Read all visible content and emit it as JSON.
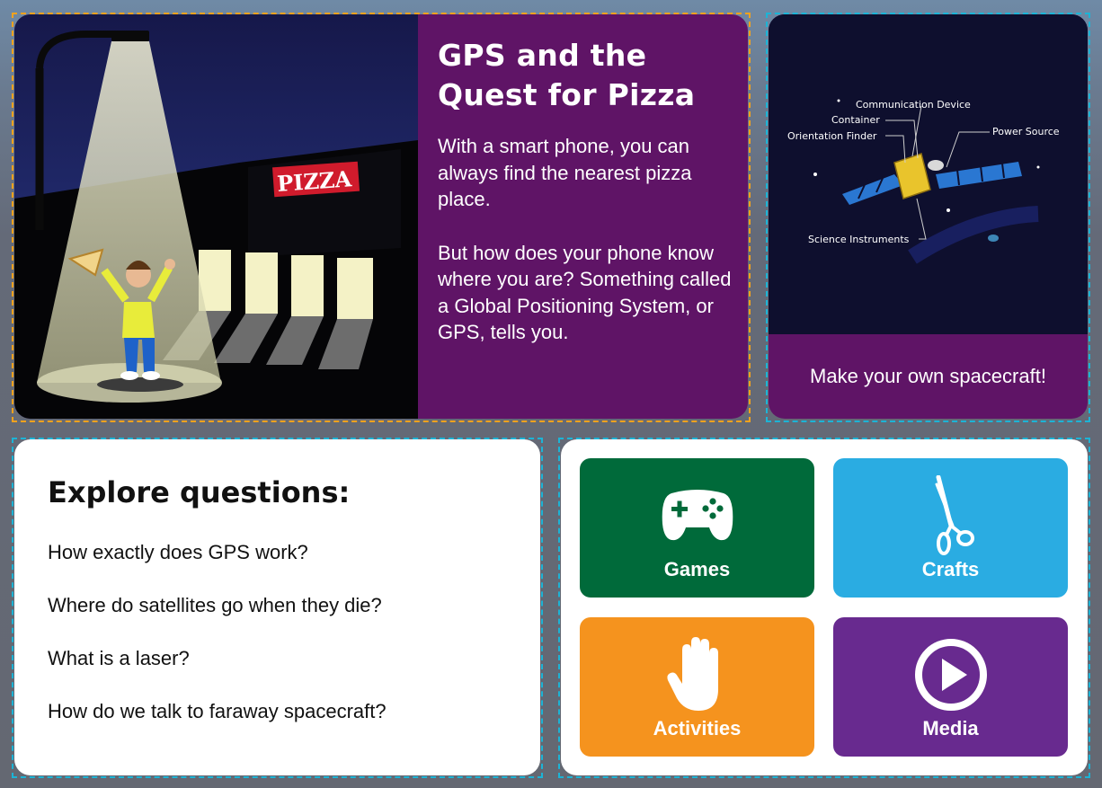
{
  "feature": {
    "title_line1": "GPS and the",
    "title_line2": "Quest for Pizza",
    "paragraph1": "With a smart phone, you can always find the nearest pizza place.",
    "paragraph2": "But how does your phone know where you are? Something called a Global Positioning System, or GPS, tells you.",
    "sign_text": "PIZZA"
  },
  "spacecraft": {
    "caption": "Make your own spacecraft!",
    "labels": {
      "communication": "Communication Device",
      "container": "Container",
      "orientation": "Orientation Finder",
      "power": "Power Source",
      "science": "Science Instruments"
    }
  },
  "explore": {
    "heading": "Explore questions:",
    "questions": [
      "How exactly does GPS work?",
      "Where do satellites go when they die?",
      "What is a laser?",
      "How do we talk to faraway spacecraft?"
    ]
  },
  "menu": {
    "games": {
      "label": "Games",
      "color": "#006a3a",
      "icon": "gamepad-icon"
    },
    "crafts": {
      "label": "Crafts",
      "color": "#2aace2",
      "icon": "scissors-icon"
    },
    "activities": {
      "label": "Activities",
      "color": "#f5931e",
      "icon": "hand-icon"
    },
    "media": {
      "label": "Media",
      "color": "#682a8f",
      "icon": "play-icon"
    }
  }
}
